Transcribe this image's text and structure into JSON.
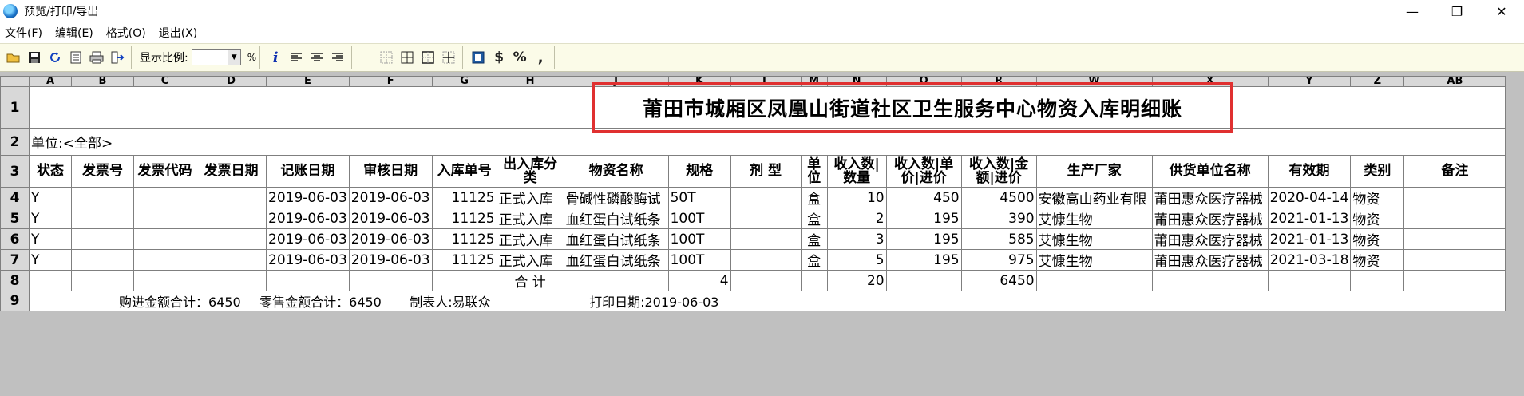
{
  "window": {
    "title": "预览/打印/导出",
    "minimize": "—",
    "maximize": "❐",
    "close": "✕"
  },
  "menu": [
    "文件(F)",
    "编辑(E)",
    "格式(O)",
    "退出(X)"
  ],
  "toolbar": {
    "zoom_label": "显示比例:",
    "zoom_value": "",
    "pct_symbol": "%",
    "info": "i",
    "dollar": "$",
    "percent": "%",
    "comma": ","
  },
  "sheet": {
    "column_letters": [
      "A",
      "B",
      "C",
      "D",
      "E",
      "F",
      "G",
      "H",
      "J",
      "K",
      "L",
      "M",
      "N",
      "O",
      "R",
      "W",
      "X",
      "Y",
      "Z",
      "AB"
    ],
    "row_numbers": [
      "1",
      "2",
      "3",
      "4",
      "5",
      "6",
      "7",
      "8",
      "9"
    ],
    "title": "莆田市城厢区凤凰山街道社区卫生服务中心物资入库明细账",
    "unit_label": "单位:<全部>",
    "headers": [
      "状态",
      "发票号",
      "发票代码",
      "发票日期",
      "记账日期",
      "审核日期",
      "入库单号",
      "出入库分类",
      "物资名称",
      "规格",
      "剂  型",
      "单位",
      "收入数|数量",
      "收入数|单价|进价",
      "收入数|金额|进价",
      "生产厂家",
      "供货单位名称",
      "有效期",
      "类别",
      "备注"
    ],
    "rows": [
      [
        "Y",
        "",
        "",
        "",
        "2019-06-03",
        "2019-06-03",
        "11125",
        "正式入库",
        "骨碱性磷酸酶试",
        "50T",
        "",
        "盒",
        "10",
        "450",
        "4500",
        "安徽高山药业有限",
        "莆田惠众医疗器械",
        "2020-04-14",
        "物资",
        ""
      ],
      [
        "Y",
        "",
        "",
        "",
        "2019-06-03",
        "2019-06-03",
        "11125",
        "正式入库",
        "血红蛋白试纸条",
        "100T",
        "",
        "盒",
        "2",
        "195",
        "390",
        "艾慷生物",
        "莆田惠众医疗器械",
        "2021-01-13",
        "物资",
        ""
      ],
      [
        "Y",
        "",
        "",
        "",
        "2019-06-03",
        "2019-06-03",
        "11125",
        "正式入库",
        "血红蛋白试纸条",
        "100T",
        "",
        "盒",
        "3",
        "195",
        "585",
        "艾慷生物",
        "莆田惠众医疗器械",
        "2021-01-13",
        "物资",
        ""
      ],
      [
        "Y",
        "",
        "",
        "",
        "2019-06-03",
        "2019-06-03",
        "11125",
        "正式入库",
        "血红蛋白试纸条",
        "100T",
        "",
        "盒",
        "5",
        "195",
        "975",
        "艾慷生物",
        "莆田惠众医疗器械",
        "2021-03-18",
        "物资",
        ""
      ]
    ],
    "total_row": {
      "label": "合  计",
      "count": "4",
      "qty": "20",
      "amount": "6450"
    },
    "footer": {
      "purchase_total": "购进金额合计：6450",
      "retail_total": "零售金额合计：6450",
      "maker": "制表人:易联众",
      "print_date": "打印日期:2019-06-03"
    }
  },
  "colors": {
    "highlight_border": "#e03030",
    "toolbar_bg": "#fbfbe8",
    "sheet_bg": "#c0c0c0"
  }
}
